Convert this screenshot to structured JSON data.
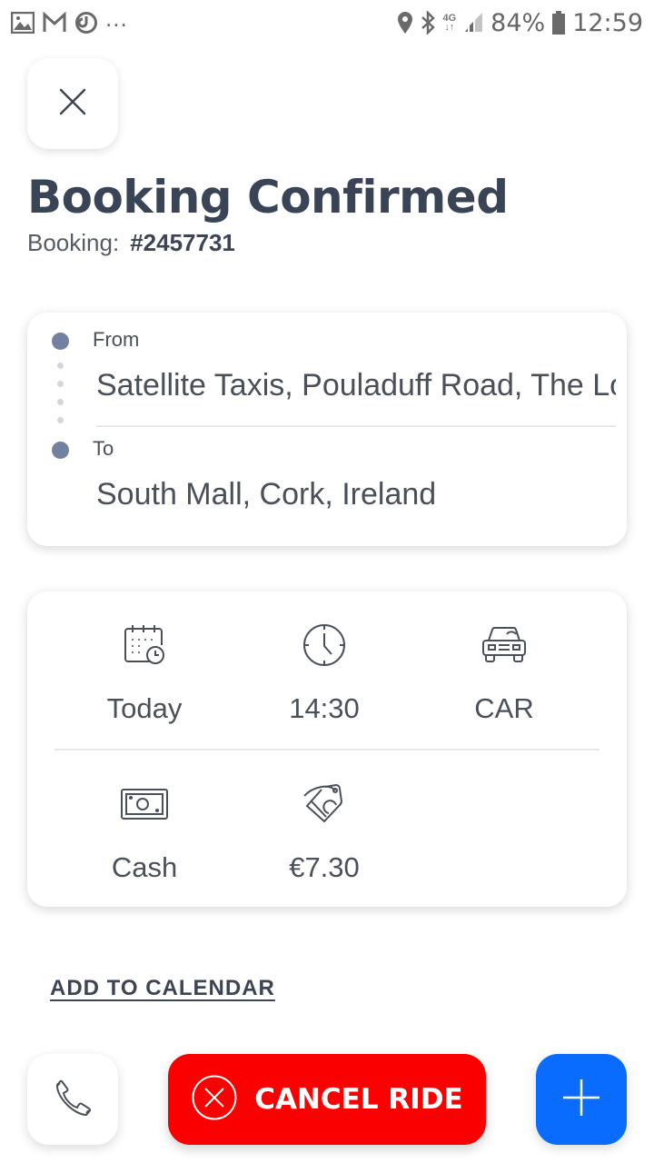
{
  "status_bar": {
    "left_icons": [
      "gallery-icon",
      "gmail-icon",
      "sync-icon"
    ],
    "overflow": "...",
    "network": "4G",
    "battery": "84%",
    "time": "12:59"
  },
  "header": {
    "close_icon": "close-icon",
    "title": "Booking Confirmed",
    "booking_label": "Booking:",
    "booking_number": "#2457731"
  },
  "route": {
    "from_label": "From",
    "from_address": "Satellite Taxis, Pouladuff Road, The Lough, Cork",
    "to_label": "To",
    "to_address": "South Mall, Cork, Ireland",
    "dot_color": "#7480a0"
  },
  "details": {
    "date": {
      "icon": "calendar-clock-icon",
      "value": "Today"
    },
    "time": {
      "icon": "clock-icon",
      "value": "14:30"
    },
    "vehicle": {
      "icon": "car-icon",
      "value": "CAR"
    },
    "payment": {
      "icon": "cash-icon",
      "value": "Cash"
    },
    "price": {
      "icon": "price-tag-icon",
      "value": "€7.30"
    }
  },
  "actions": {
    "add_to_calendar": "ADD TO CALENDAR",
    "call_icon": "phone-icon",
    "cancel_label": "CANCEL RIDE",
    "cancel_color": "#fa0000",
    "add_icon": "plus-icon",
    "add_color": "#0a6cff"
  }
}
